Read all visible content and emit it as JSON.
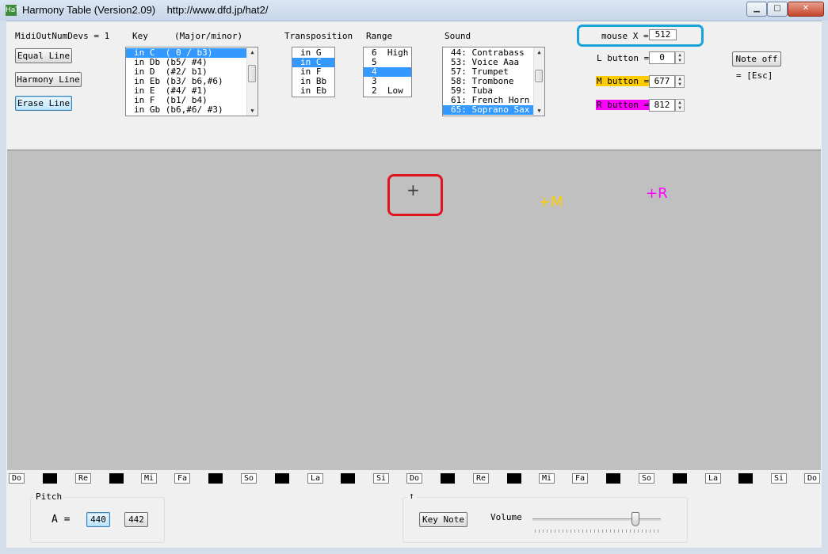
{
  "window": {
    "title": "Harmony Table (Version2.09)    http://www.dfd.jp/hat2/",
    "icon_text": "HaT"
  },
  "midi": {
    "label": "MidiOutNumDevs = 1"
  },
  "buttons": {
    "equal_line": "Equal Line",
    "harmony_line": "Harmony Line",
    "erase_line": "Erase Line",
    "note_off": "Note off",
    "esc_hint": "= [Esc]"
  },
  "key": {
    "label": "Key     (Major/minor)",
    "items": [
      "in C  ( 0 / b3)",
      "in Db (b5/ #4)",
      "in D  (#2/ b1)",
      "in Eb (b3/ b6,#6)",
      "in E  (#4/ #1)",
      "in F  (b1/ b4)",
      "in Gb (b6,#6/ #3)"
    ],
    "selected": 0
  },
  "transposition": {
    "label": "Transposition",
    "items": [
      "in G",
      "in C",
      "in F",
      "in Bb",
      "in Eb"
    ],
    "selected": 1
  },
  "range": {
    "label": "Range",
    "items": [
      "6  High",
      "5",
      "4",
      "3",
      "2  Low"
    ],
    "selected": 2
  },
  "sound": {
    "label": "Sound",
    "items": [
      "44: Contrabass",
      "53: Voice Aaa",
      "57: Trumpet",
      "58: Trombone",
      "59: Tuba",
      "61: French Horn",
      "65: Soprano Sax"
    ],
    "selected": 6
  },
  "mouse": {
    "x_label": "mouse X =",
    "x_value": "512",
    "l_label": "L button =",
    "l_value": "0",
    "m_label": "M button =",
    "m_value": "677",
    "r_label": "R button =",
    "r_value": "812"
  },
  "canvas": {
    "cursor": "+",
    "m_marker": "+M",
    "r_marker": "+R",
    "m_color": "#ffcc00",
    "r_color": "#ff00ff",
    "m_badge_color": "#ffcc00",
    "r_badge_color": "#ff00ff"
  },
  "keyboard": {
    "keys": [
      "Do",
      "",
      "Re",
      "",
      "Mi",
      "Fa",
      "",
      "So",
      "",
      "La",
      "",
      "Si",
      "Do",
      "",
      "Re",
      "",
      "Mi",
      "Fa",
      "",
      "So",
      "",
      "La",
      "",
      "Si",
      "Do"
    ]
  },
  "pitch": {
    "label": "Pitch",
    "a_label": "A =",
    "btn_440": "440",
    "btn_442": "442"
  },
  "volume": {
    "arrow": "↑",
    "key_note": "Key Note",
    "label": "Volume",
    "level": 0.8
  }
}
